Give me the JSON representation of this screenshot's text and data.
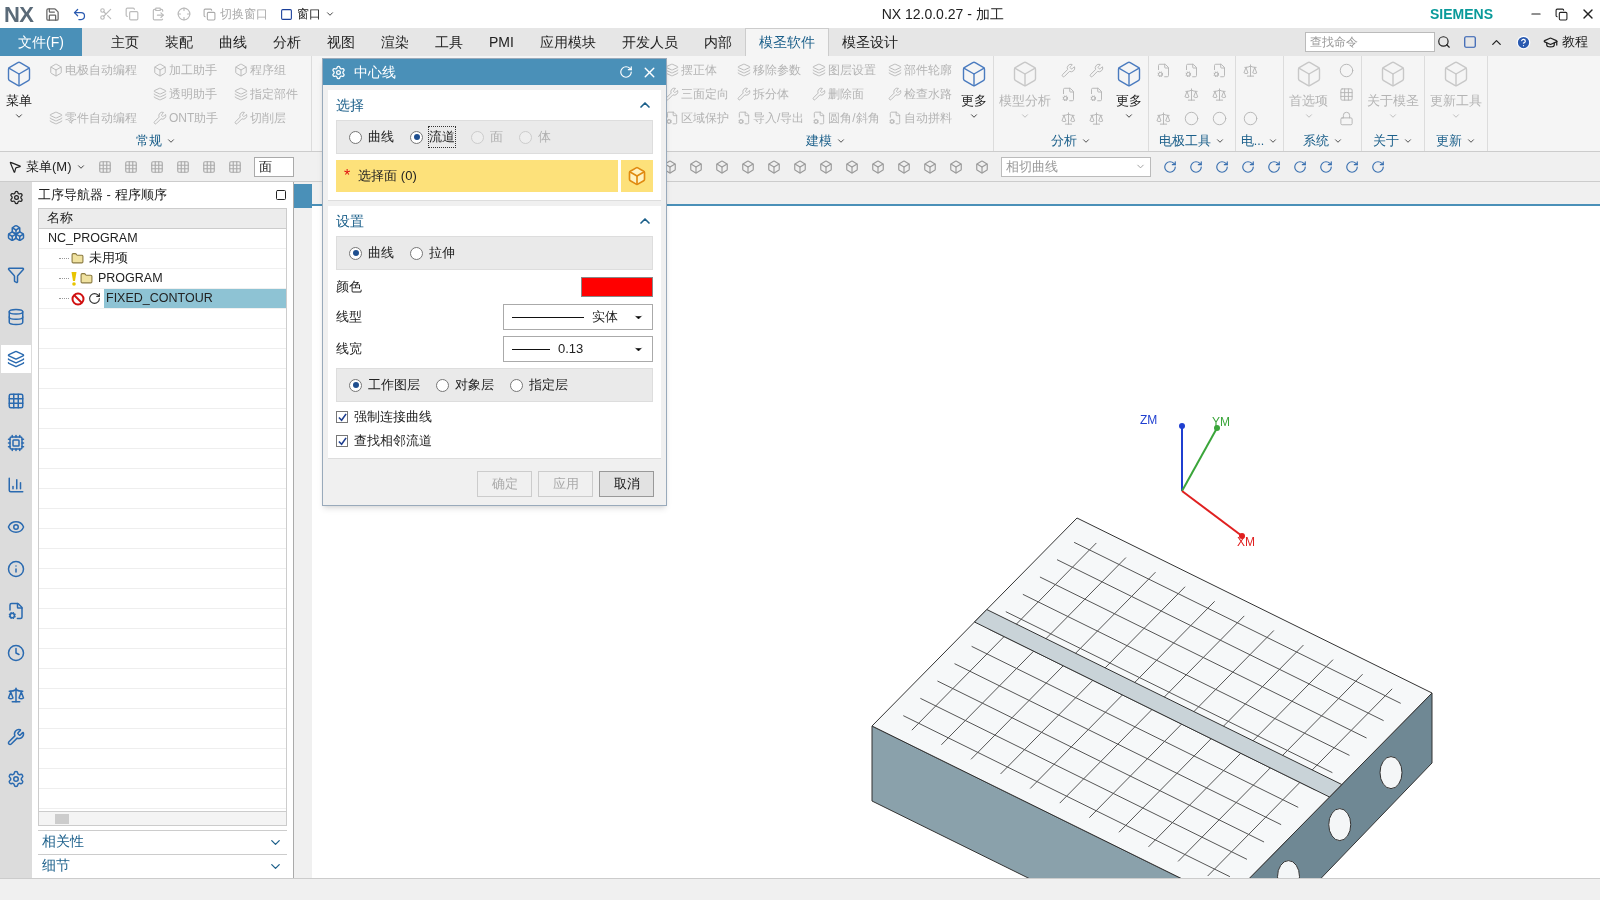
{
  "title_bar": {
    "logo": "NX",
    "switch_window": "切换窗口",
    "window_menu": "窗口",
    "title": "NX 12.0.0.27 - 加工",
    "brand": "SIEMENS"
  },
  "menu_bar": {
    "file": "文件(F)",
    "tabs": [
      {
        "label": "主页",
        "selected": false
      },
      {
        "label": "装配",
        "selected": false
      },
      {
        "label": "曲线",
        "selected": false
      },
      {
        "label": "分析",
        "selected": false
      },
      {
        "label": "视图",
        "selected": false
      },
      {
        "label": "渲染",
        "selected": false
      },
      {
        "label": "工具",
        "selected": false
      },
      {
        "label": "PMI",
        "selected": false
      },
      {
        "label": "应用模块",
        "selected": false
      },
      {
        "label": "开发人员",
        "selected": false
      },
      {
        "label": "内部",
        "selected": false
      },
      {
        "label": "模圣软件",
        "selected": true
      },
      {
        "label": "模圣设计",
        "selected": false
      }
    ],
    "search": {
      "placeholder": "查找命令"
    },
    "tutorial": "教程"
  },
  "ribbon": {
    "groups": [
      {
        "label": "常规",
        "items": [
          {
            "kind": "big",
            "label": "菜单",
            "disabled": false
          },
          {
            "kind": "small",
            "label": "电极自动编程",
            "disabled": true
          },
          {
            "kind": "small",
            "label": "零件自动编程",
            "disabled": true
          },
          {
            "kind": "column_break"
          },
          {
            "kind": "small",
            "label": "加工助手",
            "disabled": true
          },
          {
            "kind": "small",
            "label": "透明助手",
            "disabled": true
          },
          {
            "kind": "small",
            "label": "ONT助手",
            "disabled": true
          },
          {
            "kind": "column_break"
          },
          {
            "kind": "small",
            "label": "程序组",
            "disabled": true
          },
          {
            "kind": "small",
            "label": "指定部件",
            "disabled": true
          },
          {
            "kind": "small",
            "label": "切削层",
            "disabled": true
          }
        ]
      },
      {
        "label": "建模",
        "items": [
          {
            "kind": "small",
            "label": "摆正体",
            "disabled": true
          },
          {
            "kind": "small",
            "label": "三面定向",
            "disabled": true
          },
          {
            "kind": "small",
            "label": "区域保护",
            "disabled": true
          },
          {
            "kind": "column_break"
          },
          {
            "kind": "small",
            "label": "移除参数",
            "disabled": true
          },
          {
            "kind": "small",
            "label": "拆分体",
            "disabled": true
          },
          {
            "kind": "small",
            "label": "导入/导出",
            "disabled": true
          },
          {
            "kind": "column_break"
          },
          {
            "kind": "small",
            "label": "图层设置",
            "disabled": true
          },
          {
            "kind": "small",
            "label": "删除面",
            "disabled": true
          },
          {
            "kind": "small",
            "label": "圆角/斜角",
            "disabled": true
          },
          {
            "kind": "column_break"
          },
          {
            "kind": "small",
            "label": "部件轮廓",
            "disabled": true
          },
          {
            "kind": "small",
            "label": "检查水路",
            "disabled": true
          },
          {
            "kind": "small",
            "label": "自动拼料",
            "disabled": true
          },
          {
            "kind": "big",
            "label": "更多",
            "disabled": false
          }
        ]
      },
      {
        "label": "分析",
        "items": [
          {
            "kind": "big",
            "label": "模型分析",
            "disabled": true
          },
          {
            "kind": "icon",
            "disabled": true
          },
          {
            "kind": "icon",
            "disabled": true
          },
          {
            "kind": "icon",
            "disabled": true
          },
          {
            "kind": "column_break"
          },
          {
            "kind": "icon",
            "disabled": true
          },
          {
            "kind": "icon",
            "disabled": true
          },
          {
            "kind": "icon",
            "disabled": true
          },
          {
            "kind": "big",
            "label": "更多",
            "disabled": false
          }
        ]
      },
      {
        "label": "电极工具",
        "items": [
          {
            "kind": "icon",
            "disabled": true
          },
          {
            "kind": "icon",
            "disabled": true
          },
          {
            "kind": "column_break"
          },
          {
            "kind": "icon",
            "disabled": true
          },
          {
            "kind": "icon",
            "disabled": true
          },
          {
            "kind": "icon",
            "disabled": true
          },
          {
            "kind": "column_break"
          },
          {
            "kind": "icon",
            "disabled": true
          },
          {
            "kind": "icon",
            "disabled": true
          },
          {
            "kind": "icon",
            "disabled": true
          }
        ]
      },
      {
        "label": "电...",
        "items": [
          {
            "kind": "icon",
            "disabled": true
          },
          {
            "kind": "icon",
            "disabled": true
          }
        ]
      },
      {
        "label": "系统",
        "items": [
          {
            "kind": "big",
            "label": "首选项",
            "disabled": true
          },
          {
            "kind": "icon",
            "disabled": true
          },
          {
            "kind": "icon",
            "disabled": true
          },
          {
            "kind": "icon",
            "disabled": true
          }
        ]
      },
      {
        "label": "关于",
        "items": [
          {
            "kind": "big",
            "label": "关于模圣",
            "disabled": true
          }
        ]
      },
      {
        "label": "更新",
        "items": [
          {
            "kind": "big",
            "label": "更新工具",
            "disabled": true
          }
        ]
      }
    ]
  },
  "toolbar": {
    "menu": "菜单(M)",
    "filter_value": "面",
    "curve_rule": "相切曲线"
  },
  "resource_bar": {
    "tabs": [
      {
        "selected": false
      },
      {
        "selected": false
      },
      {
        "selected": false
      },
      {
        "selected": true
      },
      {
        "selected": false
      },
      {
        "selected": false
      },
      {
        "selected": false
      },
      {
        "selected": false
      },
      {
        "selected": false
      },
      {
        "selected": false
      },
      {
        "selected": false
      },
      {
        "selected": false
      },
      {
        "selected": false
      },
      {
        "selected": false
      }
    ]
  },
  "navigator": {
    "title": "工序导航器 - 程序顺序",
    "column": "名称",
    "tree": [
      {
        "label": "NC_PROGRAM",
        "selected": false,
        "children": [
          {
            "label": "未用项",
            "kind": "group",
            "warning": false,
            "blocked": false,
            "selected": false
          },
          {
            "label": "PROGRAM",
            "kind": "group",
            "warning": true,
            "blocked": false,
            "selected": false
          },
          {
            "label": "FIXED_CONTOUR",
            "kind": "operation",
            "warning": false,
            "blocked": true,
            "selected": true
          }
        ]
      }
    ],
    "panels": [
      {
        "label": "相关性",
        "expanded": false
      },
      {
        "label": "细节",
        "expanded": false
      }
    ]
  },
  "dialog": {
    "title": "中心线",
    "select_section": {
      "title": "选择",
      "expanded": true,
      "options": [
        {
          "label": "曲线",
          "selected": false,
          "disabled": false
        },
        {
          "label": "流道",
          "selected": true,
          "disabled": false
        },
        {
          "label": "面",
          "selected": false,
          "disabled": true
        },
        {
          "label": "体",
          "selected": false,
          "disabled": true
        }
      ],
      "select_face": {
        "mark": "*",
        "label": "选择面 (0)"
      }
    },
    "settings_section": {
      "title": "设置",
      "expanded": true,
      "mode_options": [
        {
          "label": "曲线",
          "selected": true
        },
        {
          "label": "拉伸",
          "selected": false
        }
      ],
      "color": {
        "label": "颜色",
        "color": "#ff0000"
      },
      "line_type": {
        "label": "线型",
        "value": "实体"
      },
      "line_width": {
        "label": "线宽",
        "value": "0.13"
      },
      "layer_options": [
        {
          "label": "工作图层",
          "selected": true
        },
        {
          "label": "对象层",
          "selected": false
        },
        {
          "label": "指定层",
          "selected": false
        }
      ],
      "checkboxes": [
        {
          "label": "强制连接曲线",
          "checked": true
        },
        {
          "label": "查找相邻流道",
          "checked": true
        }
      ]
    },
    "buttons": [
      {
        "label": "确定",
        "disabled": true
      },
      {
        "label": "应用",
        "disabled": true
      },
      {
        "label": "取消",
        "disabled": false
      }
    ]
  },
  "viewport": {
    "axes": [
      {
        "label": "ZM",
        "color": "#1f3fd0"
      },
      {
        "label": "YM",
        "color": "#3aa53a"
      },
      {
        "label": "XM",
        "color": "#e02020"
      }
    ]
  }
}
